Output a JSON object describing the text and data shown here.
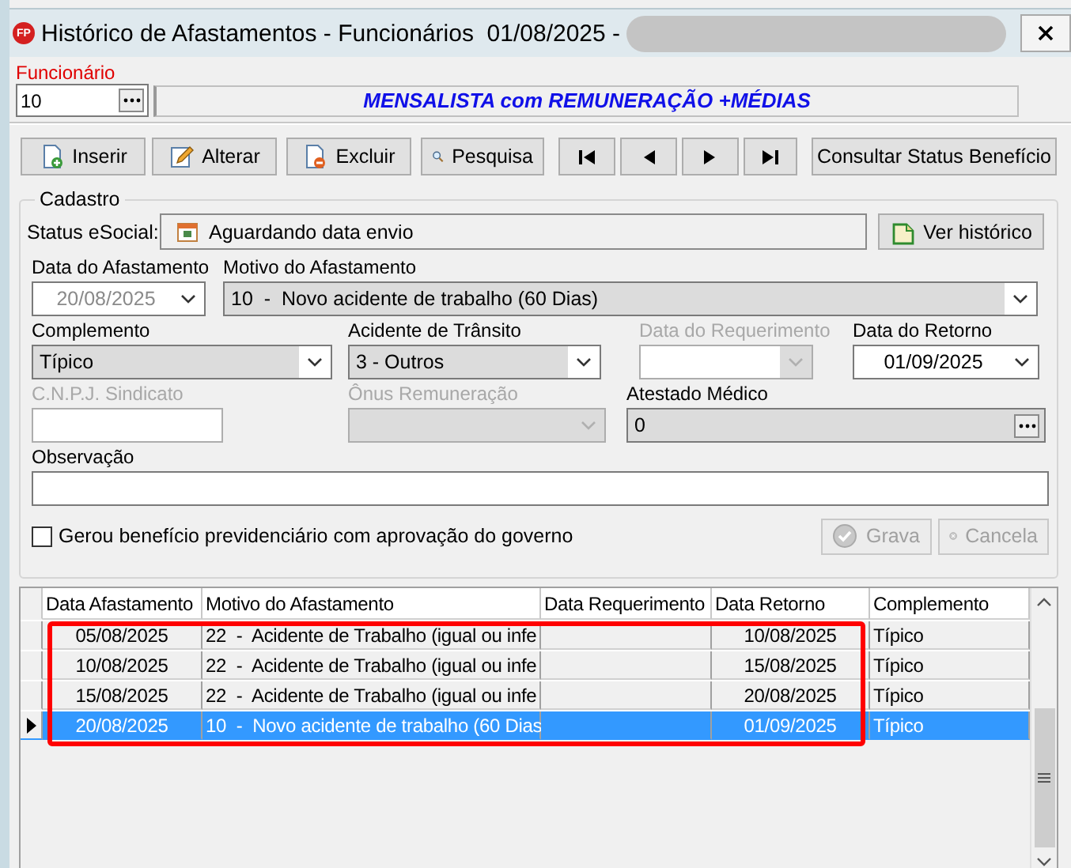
{
  "window": {
    "app_badge": "FP",
    "title": "Histórico de Afastamentos - Funcionários  01/08/2025 -",
    "title_redacted": true
  },
  "funcionario": {
    "label": "Funcionário",
    "code": "10",
    "description": "MENSALISTA com REMUNERAÇÃO +MÉDIAS"
  },
  "toolbar": [
    {
      "kind": "insert",
      "label": "Inserir"
    },
    {
      "kind": "edit",
      "label": "Alterar"
    },
    {
      "kind": "delete",
      "label": "Excluir"
    },
    {
      "kind": "search",
      "label": "Pesquisa"
    },
    {
      "kind": "first"
    },
    {
      "kind": "prev"
    },
    {
      "kind": "next"
    },
    {
      "kind": "last"
    },
    {
      "kind": "plain",
      "label": "Consultar Status Benefício"
    }
  ],
  "cadastro": {
    "title": "Cadastro",
    "status_label": "Status eSocial:",
    "status_value": "Aguardando data envio",
    "history_button": "Ver histórico",
    "field_rows": [
      [
        {
          "label": "Data do Afastamento",
          "kind": "combo",
          "value": "20/08/2025",
          "disabled": false,
          "filled": false,
          "value_greyed": true
        },
        {
          "label": "Motivo do Afastamento",
          "kind": "combo",
          "value": "10  -  Novo acidente de trabalho (60 Dias)",
          "disabled": false,
          "filled": true,
          "value_greyed": false
        }
      ],
      [
        {
          "label": "Complemento",
          "kind": "combo",
          "value": "Típico",
          "disabled": false,
          "filled": true,
          "value_greyed": false
        },
        {
          "label": "Acidente de Trânsito",
          "kind": "combo",
          "value": "3 - Outros",
          "disabled": false,
          "filled": true,
          "value_greyed": false
        },
        {
          "label": "Data do Requerimento",
          "kind": "combo",
          "disabled": true,
          "filled": false
        },
        {
          "label": "Data do Retorno",
          "kind": "combo",
          "value": "01/09/2025",
          "disabled": false,
          "filled": false,
          "value_greyed": false
        }
      ],
      [
        {
          "label": "C.N.P.J. Sindicato",
          "kind": "text",
          "disabled": true,
          "filled": false
        },
        {
          "label": "Ônus Remuneração",
          "kind": "combo",
          "disabled": true,
          "filled": true
        },
        {
          "label": "Atestado Médico",
          "kind": "lookup",
          "value": "0",
          "disabled": false,
          "filled": true,
          "value_greyed": false
        }
      ],
      [
        {
          "label": "Observação",
          "kind": "text",
          "disabled": false,
          "filled": false
        }
      ]
    ],
    "checkbox": {
      "label": "Gerou benefício previdenciário com aprovação do governo",
      "checked": false
    },
    "actions": [
      {
        "kind": "save",
        "label": "Grava",
        "disabled": true
      },
      {
        "kind": "cancel",
        "label": "Cancela",
        "disabled": true
      }
    ]
  },
  "table": {
    "columns": [
      "Data Afastamento",
      "Motivo do Afastamento",
      "Data Requerimento",
      "Data Retorno",
      "Complemento"
    ],
    "rows": [
      {
        "cells": [
          "05/08/2025",
          "22  -  Acidente de Trabalho (igual ou infe",
          "",
          "10/08/2025",
          "Típico"
        ],
        "selected": false
      },
      {
        "cells": [
          "10/08/2025",
          "22  -  Acidente de Trabalho (igual ou infe",
          "",
          "15/08/2025",
          "Típico"
        ],
        "selected": false
      },
      {
        "cells": [
          "15/08/2025",
          "22  -  Acidente de Trabalho (igual ou infe",
          "",
          "20/08/2025",
          "Típico"
        ],
        "selected": false
      },
      {
        "cells": [
          "20/08/2025",
          "10  -  Novo acidente de trabalho (60 Dias",
          "",
          "01/09/2025",
          "Típico"
        ],
        "selected": true
      }
    ],
    "annotation": {
      "kind": "highlight-box"
    }
  }
}
